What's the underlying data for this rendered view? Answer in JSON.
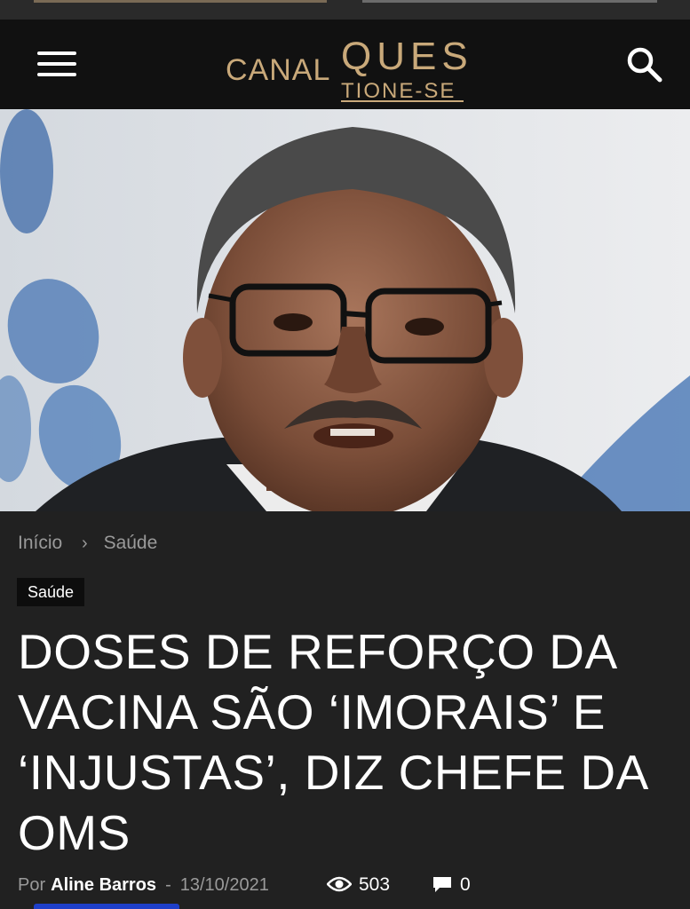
{
  "header": {
    "logo_word1": "CANAL",
    "logo_word2": "QUES",
    "logo_word3": "TIONE-SE"
  },
  "breadcrumb": {
    "home": "Início",
    "separator": "›",
    "current": "Saúde"
  },
  "category": "Saúde",
  "article": {
    "title": "DOSES DE REFORÇO DA VACINA SÃO ‘IMORAIS’ E ‘INJUSTAS’, DIZ CHEFE DA OMS",
    "by_label": "Por",
    "author": "Aline Barros",
    "dash": "-",
    "date": "13/10/2021",
    "views": "503",
    "comments": "0"
  },
  "colors": {
    "background": "#212121",
    "header": "#111111",
    "logo_gold": "#c9a97a",
    "meta_gray": "#9a9a9a",
    "accent_blue": "#1e3fc9"
  }
}
